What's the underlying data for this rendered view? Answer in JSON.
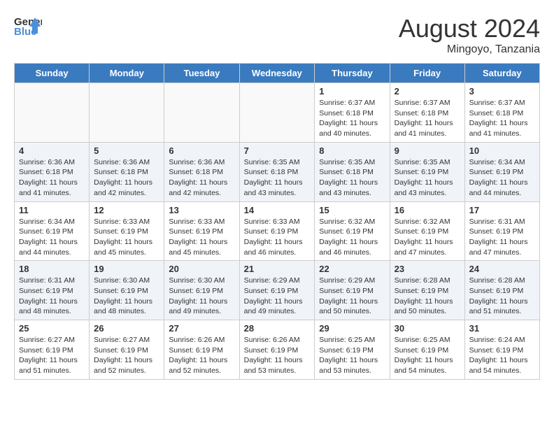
{
  "header": {
    "logo_line1": "General",
    "logo_line2": "Blue",
    "month_title": "August 2024",
    "location": "Mingoyo, Tanzania"
  },
  "weekdays": [
    "Sunday",
    "Monday",
    "Tuesday",
    "Wednesday",
    "Thursday",
    "Friday",
    "Saturday"
  ],
  "weeks": [
    [
      {
        "day": "",
        "info": ""
      },
      {
        "day": "",
        "info": ""
      },
      {
        "day": "",
        "info": ""
      },
      {
        "day": "",
        "info": ""
      },
      {
        "day": "1",
        "info": "Sunrise: 6:37 AM\nSunset: 6:18 PM\nDaylight: 11 hours\nand 40 minutes."
      },
      {
        "day": "2",
        "info": "Sunrise: 6:37 AM\nSunset: 6:18 PM\nDaylight: 11 hours\nand 41 minutes."
      },
      {
        "day": "3",
        "info": "Sunrise: 6:37 AM\nSunset: 6:18 PM\nDaylight: 11 hours\nand 41 minutes."
      }
    ],
    [
      {
        "day": "4",
        "info": "Sunrise: 6:36 AM\nSunset: 6:18 PM\nDaylight: 11 hours\nand 41 minutes."
      },
      {
        "day": "5",
        "info": "Sunrise: 6:36 AM\nSunset: 6:18 PM\nDaylight: 11 hours\nand 42 minutes."
      },
      {
        "day": "6",
        "info": "Sunrise: 6:36 AM\nSunset: 6:18 PM\nDaylight: 11 hours\nand 42 minutes."
      },
      {
        "day": "7",
        "info": "Sunrise: 6:35 AM\nSunset: 6:18 PM\nDaylight: 11 hours\nand 43 minutes."
      },
      {
        "day": "8",
        "info": "Sunrise: 6:35 AM\nSunset: 6:18 PM\nDaylight: 11 hours\nand 43 minutes."
      },
      {
        "day": "9",
        "info": "Sunrise: 6:35 AM\nSunset: 6:19 PM\nDaylight: 11 hours\nand 43 minutes."
      },
      {
        "day": "10",
        "info": "Sunrise: 6:34 AM\nSunset: 6:19 PM\nDaylight: 11 hours\nand 44 minutes."
      }
    ],
    [
      {
        "day": "11",
        "info": "Sunrise: 6:34 AM\nSunset: 6:19 PM\nDaylight: 11 hours\nand 44 minutes."
      },
      {
        "day": "12",
        "info": "Sunrise: 6:33 AM\nSunset: 6:19 PM\nDaylight: 11 hours\nand 45 minutes."
      },
      {
        "day": "13",
        "info": "Sunrise: 6:33 AM\nSunset: 6:19 PM\nDaylight: 11 hours\nand 45 minutes."
      },
      {
        "day": "14",
        "info": "Sunrise: 6:33 AM\nSunset: 6:19 PM\nDaylight: 11 hours\nand 46 minutes."
      },
      {
        "day": "15",
        "info": "Sunrise: 6:32 AM\nSunset: 6:19 PM\nDaylight: 11 hours\nand 46 minutes."
      },
      {
        "day": "16",
        "info": "Sunrise: 6:32 AM\nSunset: 6:19 PM\nDaylight: 11 hours\nand 47 minutes."
      },
      {
        "day": "17",
        "info": "Sunrise: 6:31 AM\nSunset: 6:19 PM\nDaylight: 11 hours\nand 47 minutes."
      }
    ],
    [
      {
        "day": "18",
        "info": "Sunrise: 6:31 AM\nSunset: 6:19 PM\nDaylight: 11 hours\nand 48 minutes."
      },
      {
        "day": "19",
        "info": "Sunrise: 6:30 AM\nSunset: 6:19 PM\nDaylight: 11 hours\nand 48 minutes."
      },
      {
        "day": "20",
        "info": "Sunrise: 6:30 AM\nSunset: 6:19 PM\nDaylight: 11 hours\nand 49 minutes."
      },
      {
        "day": "21",
        "info": "Sunrise: 6:29 AM\nSunset: 6:19 PM\nDaylight: 11 hours\nand 49 minutes."
      },
      {
        "day": "22",
        "info": "Sunrise: 6:29 AM\nSunset: 6:19 PM\nDaylight: 11 hours\nand 50 minutes."
      },
      {
        "day": "23",
        "info": "Sunrise: 6:28 AM\nSunset: 6:19 PM\nDaylight: 11 hours\nand 50 minutes."
      },
      {
        "day": "24",
        "info": "Sunrise: 6:28 AM\nSunset: 6:19 PM\nDaylight: 11 hours\nand 51 minutes."
      }
    ],
    [
      {
        "day": "25",
        "info": "Sunrise: 6:27 AM\nSunset: 6:19 PM\nDaylight: 11 hours\nand 51 minutes."
      },
      {
        "day": "26",
        "info": "Sunrise: 6:27 AM\nSunset: 6:19 PM\nDaylight: 11 hours\nand 52 minutes."
      },
      {
        "day": "27",
        "info": "Sunrise: 6:26 AM\nSunset: 6:19 PM\nDaylight: 11 hours\nand 52 minutes."
      },
      {
        "day": "28",
        "info": "Sunrise: 6:26 AM\nSunset: 6:19 PM\nDaylight: 11 hours\nand 53 minutes."
      },
      {
        "day": "29",
        "info": "Sunrise: 6:25 AM\nSunset: 6:19 PM\nDaylight: 11 hours\nand 53 minutes."
      },
      {
        "day": "30",
        "info": "Sunrise: 6:25 AM\nSunset: 6:19 PM\nDaylight: 11 hours\nand 54 minutes."
      },
      {
        "day": "31",
        "info": "Sunrise: 6:24 AM\nSunset: 6:19 PM\nDaylight: 11 hours\nand 54 minutes."
      }
    ]
  ]
}
